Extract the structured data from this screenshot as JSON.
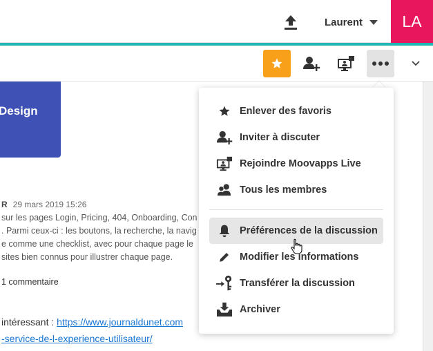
{
  "topbar": {
    "user_name": "Laurent",
    "avatar_initials": "LA",
    "avatar_color": "#e8175d",
    "accent_line_color": "#1fb5b3"
  },
  "toolbar": {
    "favorite_color": "#f9a01b",
    "icons": [
      "star-icon",
      "invite-user-icon",
      "live-screen-icon",
      "more-icon",
      "chevron-down-icon"
    ]
  },
  "background": {
    "card_text": "Design",
    "meta_author": "R",
    "meta_date": "29 mars 2019 15:26",
    "lines": [
      "sur les pages Login, Pricing, 404, Onboarding, Con",
      ". Parmi ceux-ci : les boutons, la recherche, la navig",
      "e comme une checklist, avec pour chaque page le",
      "sites bien connus pour illustrer chaque page."
    ],
    "comments": "1 commentaire",
    "bottom_text": "intéressant : ",
    "bottom_link": "https://www.journaldunet.com",
    "bottom_link_2": "-service-de-l-experience-utilisateur/"
  },
  "menu": {
    "items": [
      {
        "label": "Enlever des favoris",
        "icon": "star-icon"
      },
      {
        "label": "Inviter à discuter",
        "icon": "invite-user-icon"
      },
      {
        "label": "Rejoindre Moovapps Live",
        "icon": "live-screen-icon"
      },
      {
        "label": "Tous les membres",
        "icon": "members-icon"
      },
      {
        "label": "Préférences de la discussion",
        "icon": "bell-icon"
      },
      {
        "label": "Modifier les informations",
        "icon": "pencil-icon"
      },
      {
        "label": "Transférer la discussion",
        "icon": "transfer-key-icon"
      },
      {
        "label": "Archiver",
        "icon": "archive-icon"
      }
    ],
    "highlighted_index": 4
  }
}
